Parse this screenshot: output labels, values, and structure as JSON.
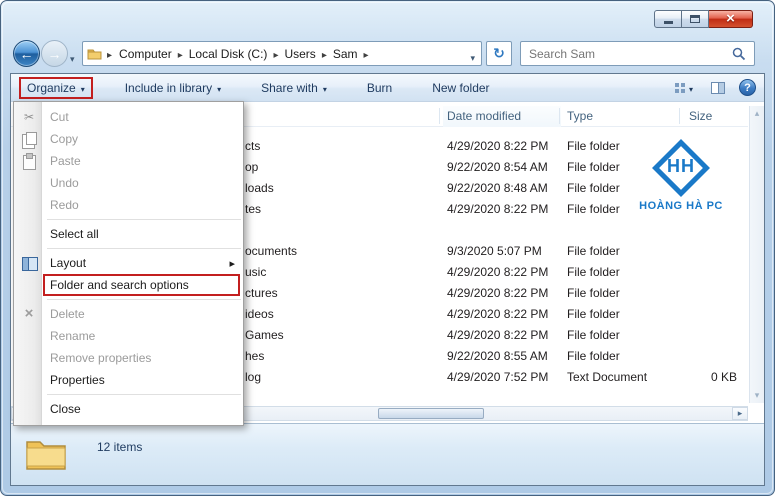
{
  "window": {
    "controls": [
      "minimize",
      "maximize",
      "close"
    ]
  },
  "navbar": {
    "breadcrumb": {
      "items": [
        {
          "label": "Computer"
        },
        {
          "label": "Local Disk (C:)"
        },
        {
          "label": "Users"
        },
        {
          "label": "Sam"
        }
      ]
    },
    "search": {
      "value": "Search Sam"
    }
  },
  "toolbar": {
    "items": [
      {
        "label": "Organize",
        "dropdown": true,
        "highlighted": true
      },
      {
        "label": "Include in library",
        "dropdown": true
      },
      {
        "label": "Share with",
        "dropdown": true
      },
      {
        "label": "Burn"
      },
      {
        "label": "New folder"
      }
    ]
  },
  "organize_menu": {
    "items": [
      {
        "label": "Cut",
        "icon": "scissors",
        "disabled": true
      },
      {
        "label": "Copy",
        "icon": "copy",
        "disabled": true
      },
      {
        "label": "Paste",
        "icon": "paste",
        "disabled": true
      },
      {
        "label": "Undo",
        "disabled": true
      },
      {
        "label": "Redo",
        "disabled": true
      },
      {
        "separator": true
      },
      {
        "label": "Select all"
      },
      {
        "separator": true
      },
      {
        "label": "Layout",
        "icon": "layout",
        "submenu": true
      },
      {
        "label": "Folder and search options",
        "highlighted": true
      },
      {
        "separator": true
      },
      {
        "label": "Delete",
        "icon": "delete",
        "disabled": true
      },
      {
        "label": "Rename",
        "disabled": true
      },
      {
        "label": "Remove properties",
        "disabled": true
      },
      {
        "label": "Properties"
      },
      {
        "separator": true
      },
      {
        "label": "Close"
      }
    ]
  },
  "file_list": {
    "columns": [
      "Date modified",
      "Type",
      "Size"
    ],
    "rows": [
      {
        "name": "cts",
        "date": "4/29/2020 8:22 PM",
        "type": "File folder",
        "size": ""
      },
      {
        "name": "op",
        "date": "9/22/2020 8:54 AM",
        "type": "File folder",
        "size": ""
      },
      {
        "name": "loads",
        "date": "9/22/2020 8:48 AM",
        "type": "File folder",
        "size": ""
      },
      {
        "name": "tes",
        "date": "4/29/2020 8:22 PM",
        "type": "File folder",
        "size": ""
      },
      {
        "name": "",
        "date": "",
        "type": "",
        "size": ""
      },
      {
        "name": "ocuments",
        "date": "9/3/2020 5:07 PM",
        "type": "File folder",
        "size": ""
      },
      {
        "name": "usic",
        "date": "4/29/2020 8:22 PM",
        "type": "File folder",
        "size": ""
      },
      {
        "name": "ctures",
        "date": "4/29/2020 8:22 PM",
        "type": "File folder",
        "size": ""
      },
      {
        "name": "ideos",
        "date": "4/29/2020 8:22 PM",
        "type": "File folder",
        "size": ""
      },
      {
        "name": "Games",
        "date": "4/29/2020 8:22 PM",
        "type": "File folder",
        "size": ""
      },
      {
        "name": "hes",
        "date": "9/22/2020 8:55 AM",
        "type": "File folder",
        "size": ""
      },
      {
        "name": "log",
        "date": "4/29/2020 7:52 PM",
        "type": "Text Document",
        "size": "0 KB"
      }
    ]
  },
  "logo": {
    "monogram": "HH",
    "text": "HOÀNG HÀ PC"
  },
  "statusbar": {
    "items_count": "12 items"
  },
  "annotation": {
    "color": "#c31f1f"
  }
}
